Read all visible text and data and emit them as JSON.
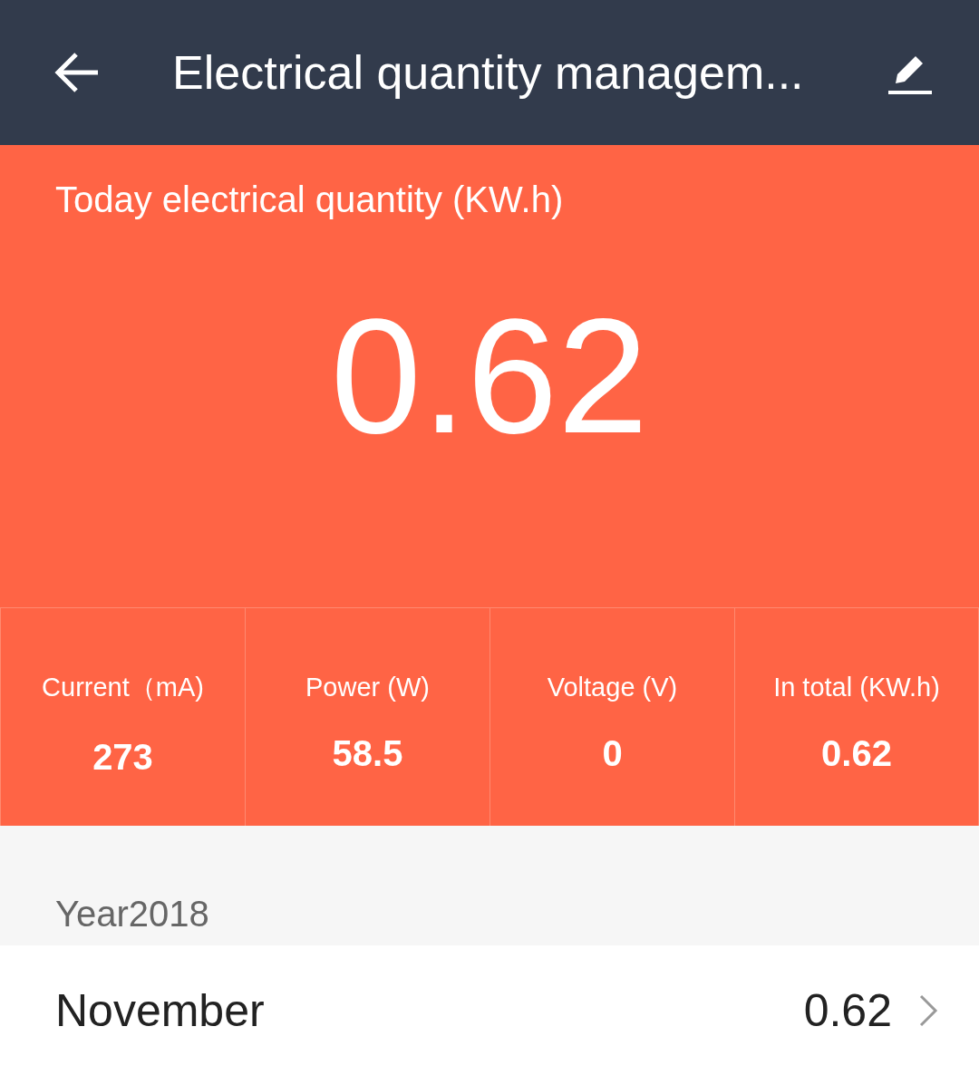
{
  "header": {
    "title": "Electrical quantity managem..."
  },
  "today": {
    "label": "Today electrical quantity (KW.h)",
    "value": "0.62"
  },
  "stats": [
    {
      "label": "Current（mA)",
      "value": "273"
    },
    {
      "label": "Power (W)",
      "value": "58.5"
    },
    {
      "label": "Voltage (V)",
      "value": "0"
    },
    {
      "label": "In total (KW.h)",
      "value": "0.62"
    }
  ],
  "year": {
    "label": "Year2018"
  },
  "months": [
    {
      "name": "November",
      "value": "0.62"
    }
  ]
}
